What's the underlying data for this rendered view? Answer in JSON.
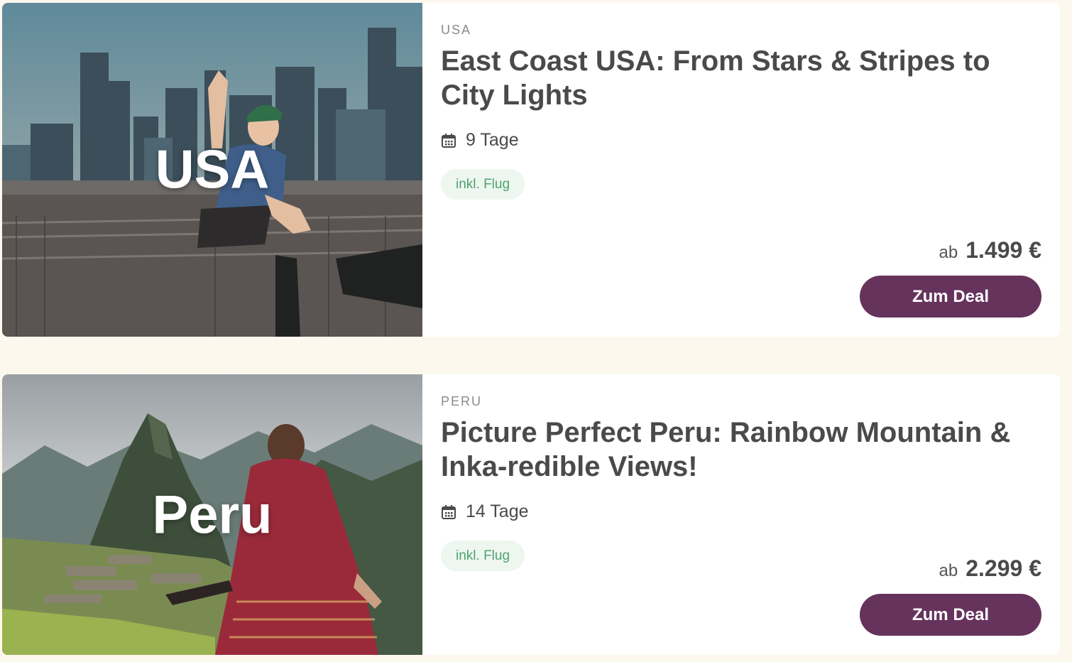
{
  "colors": {
    "page_background": "#fdf8ee",
    "card_background": "#ffffff",
    "title_text": "#4a4a4a",
    "badge_bg": "#eef6f0",
    "badge_text": "#4ea36c",
    "button_bg": "#66335c",
    "button_text": "#ffffff"
  },
  "deals": [
    {
      "image_label": "USA",
      "image_icon": "new-york-skyline-traveler-photo",
      "country": "USA",
      "title": "East Coast USA: From Stars & Stripes to City Lights",
      "duration_icon": "calendar-icon",
      "duration": "9 Tage",
      "badge": "inkl. Flug",
      "price_prefix": "ab",
      "price": "1.499 €",
      "button_label": "Zum Deal"
    },
    {
      "image_label": "Peru",
      "image_icon": "machu-picchu-traveler-photo",
      "country": "PERU",
      "title": "Picture Perfect Peru: Rainbow Mountain & Inka-redible Views!",
      "duration_icon": "calendar-icon",
      "duration": "14 Tage",
      "badge": "inkl. Flug",
      "price_prefix": "ab",
      "price": "2.299 €",
      "button_label": "Zum Deal"
    }
  ]
}
